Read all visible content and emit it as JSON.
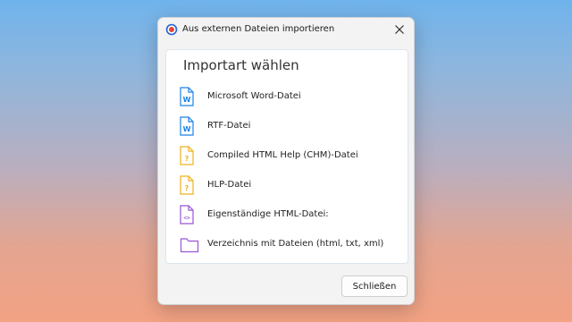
{
  "window": {
    "title": "Aus externen Dateien importieren"
  },
  "panel": {
    "heading": "Importart wählen",
    "items": [
      {
        "label": "Microsoft Word-Datei",
        "icon": "word-doc-icon",
        "icon_glyph": "W",
        "color": "#1a82e8"
      },
      {
        "label": "RTF-Datei",
        "icon": "word-doc-icon",
        "icon_glyph": "W",
        "color": "#1a82e8"
      },
      {
        "label": "Compiled HTML Help (CHM)-Datei",
        "icon": "help-file-icon",
        "icon_glyph": "?",
        "color": "#efb21a"
      },
      {
        "label": "HLP-Datei",
        "icon": "help-file-icon",
        "icon_glyph": "?",
        "color": "#efb21a"
      },
      {
        "label": "Eigenständige HTML-Datei:",
        "icon": "html-file-icon",
        "icon_glyph": "<>",
        "color": "#9a54d4"
      },
      {
        "label": "Verzeichnis mit Dateien (html, txt, xml)",
        "icon": "folder-icon",
        "icon_glyph": "",
        "color": "#9a54d4"
      }
    ]
  },
  "footer": {
    "close_label": "Schließen"
  }
}
